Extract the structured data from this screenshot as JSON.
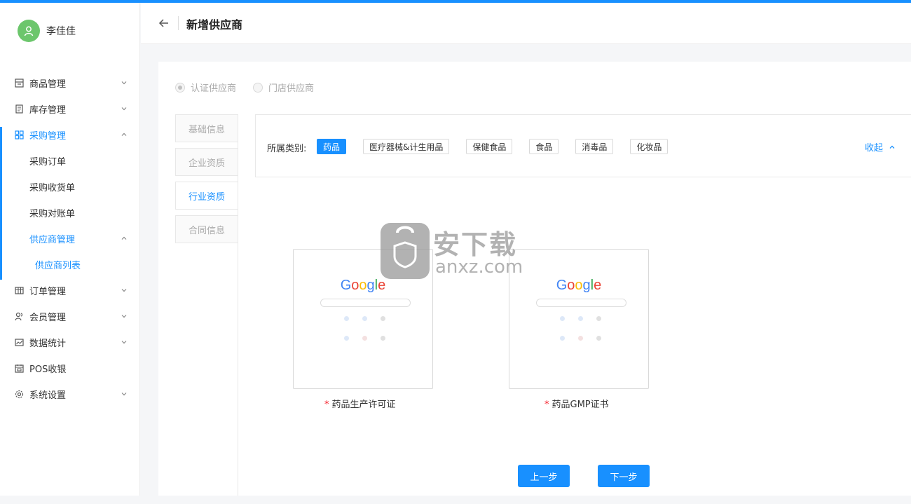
{
  "user": {
    "name": "李佳佳"
  },
  "sidebar": {
    "items": [
      {
        "label": "商品管理",
        "icon": "goods-icon"
      },
      {
        "label": "库存管理",
        "icon": "inventory-icon"
      },
      {
        "label": "采购管理",
        "icon": "grid-icon"
      },
      {
        "label": "采购订单"
      },
      {
        "label": "采购收货单"
      },
      {
        "label": "采购对账单"
      },
      {
        "label": "供应商管理"
      },
      {
        "label": "供应商列表"
      },
      {
        "label": "订单管理",
        "icon": "table-icon"
      },
      {
        "label": "会员管理",
        "icon": "member-icon"
      },
      {
        "label": "数据统计",
        "icon": "chart-icon"
      },
      {
        "label": "POS收银",
        "icon": "pos-icon"
      },
      {
        "label": "系统设置",
        "icon": "gear-icon"
      }
    ]
  },
  "header": {
    "title": "新增供应商"
  },
  "supplier_type": {
    "options": [
      "认证供应商",
      "门店供应商"
    ],
    "selected": "认证供应商"
  },
  "steps": [
    "基础信息",
    "企业资质",
    "行业资质",
    "合同信息"
  ],
  "active_step": "行业资质",
  "category": {
    "label": "所属类别:",
    "options": [
      "药品",
      "医疗器械&计生用品",
      "保健食品",
      "食品",
      "消毒品",
      "化妆品"
    ],
    "selected": "药品",
    "collapse_label": "收起"
  },
  "uploads": [
    {
      "label": "药品生产许可证",
      "required_mark": "*",
      "preview": "Google"
    },
    {
      "label": "药品GMP证书",
      "required_mark": "*",
      "preview": "Google"
    }
  ],
  "watermark": {
    "text": "安下载",
    "sub": "anxz.com"
  },
  "buttons": {
    "prev": "上一步",
    "next": "下一步"
  },
  "colors": {
    "primary": "#1890ff",
    "avatar": "#6cc66c",
    "required": "#f5222d"
  }
}
